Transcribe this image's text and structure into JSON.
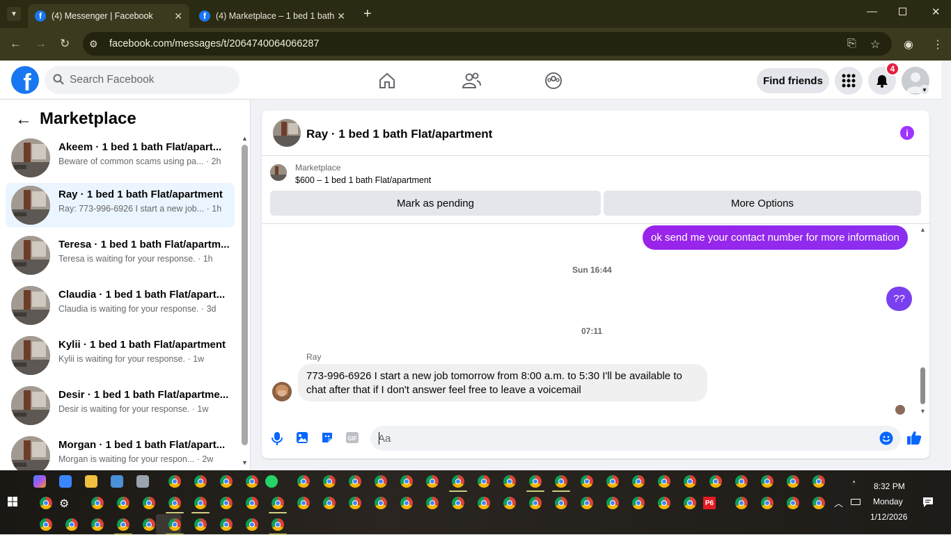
{
  "browser": {
    "tabs": [
      {
        "title": "(4) Messenger | Facebook",
        "active": true
      },
      {
        "title": "(4) Marketplace – 1 bed 1 bath",
        "active": false
      }
    ],
    "url": "facebook.com/messages/t/2064740064066287"
  },
  "fb_header": {
    "search_placeholder": "Search Facebook",
    "find_friends": "Find friends",
    "notif_count": "4"
  },
  "sidebar": {
    "title": "Marketplace",
    "conversations": [
      {
        "name": "Akeem · 1 bed 1 bath Flat/apart...",
        "preview": "Beware of common scams using pa... · 2h",
        "selected": false
      },
      {
        "name": "Ray · 1 bed 1 bath Flat/apartment",
        "preview": "Ray: 773-996-6926 I start a new job... · 1h",
        "selected": true
      },
      {
        "name": "Teresa · 1 bed 1 bath Flat/apartm...",
        "preview": "Teresa is waiting for your response. · 1h",
        "selected": false
      },
      {
        "name": "Claudia · 1 bed 1 bath Flat/apart...",
        "preview": "Claudia is waiting for your response. · 3d",
        "selected": false
      },
      {
        "name": "Kylii · 1 bed 1 bath Flat/apartment",
        "preview": "Kylii is waiting for your response. · 1w",
        "selected": false
      },
      {
        "name": "Desir · 1 bed 1 bath Flat/apartme...",
        "preview": "Desir is waiting for your response. · 1w",
        "selected": false
      },
      {
        "name": "Morgan · 1 bed 1 bath Flat/apart...",
        "preview": "Morgan is waiting for your respon... · 2w",
        "selected": false
      }
    ]
  },
  "chat": {
    "title": "Ray · 1 bed 1 bath Flat/apartment",
    "marketplace_label": "Marketplace",
    "listing": "$600 – 1 bed 1 bath Flat/apartment",
    "mark_pending": "Mark as pending",
    "more_options": "More Options",
    "messages": {
      "sent1": "ok send me your contact number for more information",
      "ts1": "Sun 16:44",
      "sent2": "??",
      "ts2": "07:11",
      "sender": "Ray",
      "received_line1": "773-996-6926  I start a new job tomorrow from 8:00 a.m. to 5:30 I'll be available to",
      "received_line2": "chat after that if I don't answer feel free to leave a voicemail"
    },
    "composer_placeholder": "Aa"
  },
  "taskbar": {
    "time": "8:32 PM",
    "day": "Monday",
    "date": "1/12/2026",
    "p6_label": "P6"
  },
  "colors": {
    "fb_blue": "#1877f2",
    "messenger_purple": "#8a2be2",
    "notif_red": "#e41e3f"
  }
}
